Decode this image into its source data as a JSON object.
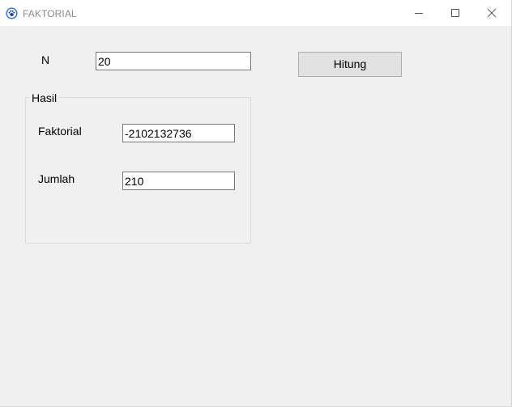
{
  "window": {
    "title": "FAKTORIAL",
    "icon": "paw-icon",
    "controls": [
      "minimize-icon",
      "maximize-icon",
      "close-icon"
    ]
  },
  "form": {
    "n_label": "N",
    "n_value": "20",
    "hitung_label": "Hitung",
    "group_title": "Hasil",
    "faktorial_label": "Faktorial",
    "faktorial_value": "-2102132736",
    "jumlah_label": "Jumlah",
    "jumlah_value": "210"
  },
  "colors": {
    "window_bg": "#f0f0f0",
    "titlebar_bg": "#ffffff",
    "button_bg": "#e1e1e1",
    "icon_blue": "#1e6fd9"
  }
}
